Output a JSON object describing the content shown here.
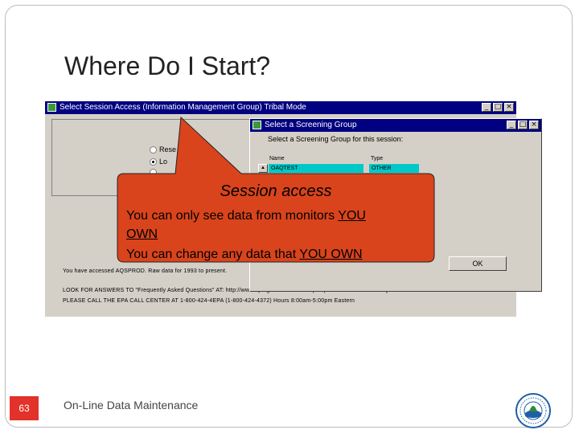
{
  "slide": {
    "title": "Where Do I Start?",
    "page_number": "63",
    "footer": "On-Line Data Maintenance"
  },
  "main_window": {
    "title": "Select Session Access (Information Management Group) Tribal Mode",
    "radios": [
      {
        "label": "Rese",
        "selected": false
      },
      {
        "label": "Lo",
        "selected": true
      },
      {
        "label": "",
        "selected": false
      }
    ],
    "info_lines": [
      "You have accessed AQSPROD. Raw data for 1993 to present.",
      "LOOK FOR ANSWERS TO \"Frequently Asked Questions\" AT: http://www.epa.gov/ttn/airs/airsaqs/aqsweb/ - 1-ROUTE-S-AQSSTAGE",
      "PLEASE CALL THE EPA CALL CENTER AT 1-800-424-4EPA (1-800-424-4372) Hours 8:00am-5:00pm Eastern"
    ]
  },
  "dialog": {
    "title": "Select a Screening Group",
    "prompt": "Select a Screening Group for this session:",
    "columns": [
      "Name",
      "Type"
    ],
    "rows": [
      [
        "OAQTEST",
        "OTHER"
      ]
    ],
    "ok_label": "OK"
  },
  "callout": {
    "title": "Session access",
    "line1_plain": "You can only see data from monitors ",
    "line1_emph": "YOU",
    "line2_emph": "OWN",
    "line3_plain": "You can change any data that ",
    "line3_emph": "YOU OWN",
    "fill": "#d9441c"
  },
  "colors": {
    "titlebar": "#000080",
    "page_number_bg": "#e2322a",
    "cell_highlight": "#00c8c8"
  },
  "logo": {
    "icon": "epa-seal-icon"
  }
}
